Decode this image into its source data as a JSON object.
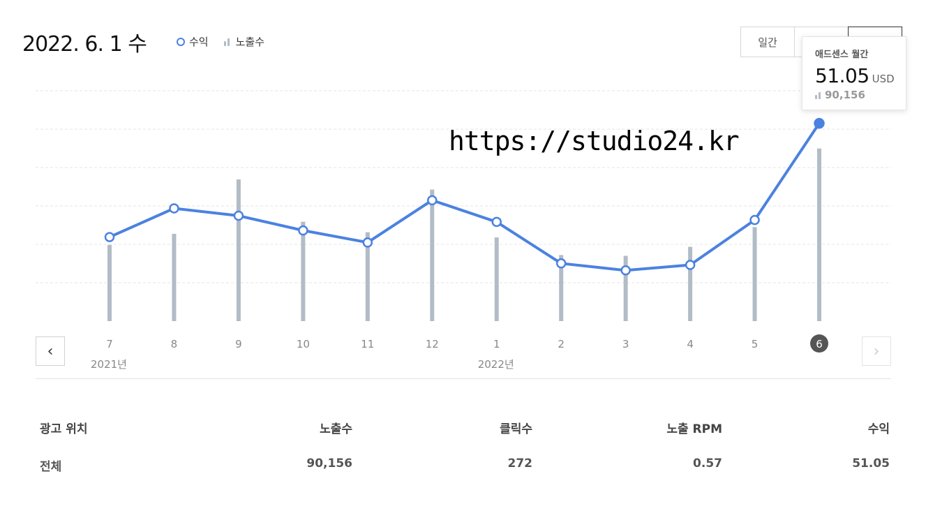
{
  "header": {
    "date": "2022. 6. 1 수",
    "legend": {
      "revenue_label": "수익",
      "impressions_label": "노출수"
    },
    "period_tabs": [
      "일간",
      "",
      ""
    ],
    "active_tab_index": 2
  },
  "tooltip": {
    "title": "애드센스 월간",
    "value": "51.05",
    "unit": "USD",
    "impressions": "90,156"
  },
  "watermark": "https://studio24.kr",
  "colors": {
    "line": "#4b82e0",
    "bar": "#b2bcc6",
    "grid": "#e6e6e6",
    "selected_month_bg": "#555555"
  },
  "nav": {
    "prev_icon": "‹",
    "next_icon": "›"
  },
  "year_labels": [
    {
      "label": "2021년",
      "month_index": 0
    },
    {
      "label": "2022년",
      "month_index": 6
    }
  ],
  "chart_data": {
    "type": "line",
    "categories": [
      "7",
      "8",
      "9",
      "10",
      "11",
      "12",
      "1",
      "2",
      "3",
      "4",
      "5",
      "6"
    ],
    "selected_index": 11,
    "series": [
      {
        "name": "수익",
        "type": "line",
        "values": [
          21.7,
          29.1,
          27.2,
          23.4,
          20.3,
          31.2,
          25.6,
          14.9,
          13.1,
          14.5,
          26.1,
          51.05
        ]
      },
      {
        "name": "노출수",
        "type": "bar",
        "values": [
          39800,
          45600,
          74000,
          51900,
          46400,
          68700,
          43700,
          34500,
          34100,
          38800,
          49100,
          90156
        ]
      }
    ],
    "grid": true
  },
  "table": {
    "headers": [
      "광고 위치",
      "노출수",
      "클릭수",
      "노출 RPM",
      "수익"
    ],
    "rows": [
      [
        "전체",
        "90,156",
        "272",
        "0.57",
        "51.05"
      ]
    ]
  }
}
